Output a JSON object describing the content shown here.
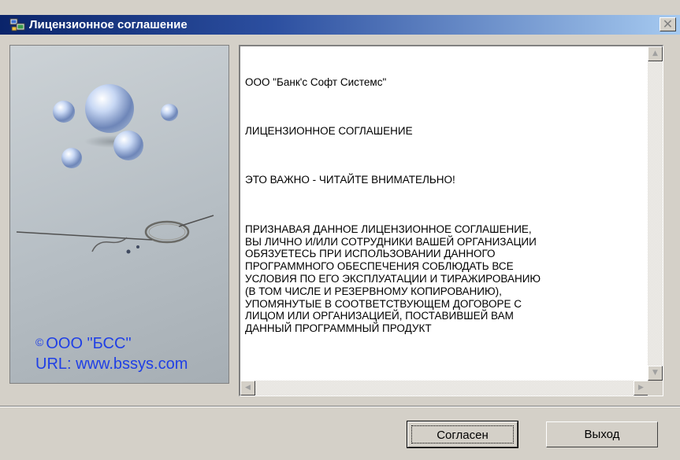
{
  "window": {
    "title": "Лицензионное соглашение",
    "close_symbol": "✕"
  },
  "image_panel": {
    "copyright_symbol": "©",
    "copyright_text": "ООО \"БСС\"",
    "url_text": "URL: www.bssys.com"
  },
  "license": {
    "paragraphs": [
      "ООО \"Банк'с Софт Системс\"",
      "ЛИЦЕНЗИОННОЕ СОГЛАШЕНИЕ",
      "ЭТО ВАЖНО - ЧИТАЙТЕ ВНИМАТЕЛЬНО!",
      "ПРИЗНАВАЯ ДАННОЕ ЛИЦЕНЗИОННОЕ СОГЛАШЕНИЕ,\nВЫ ЛИЧНО И/ИЛИ СОТРУДНИКИ ВАШЕЙ ОРГАНИЗАЦИИ\nОБЯЗУЕТЕСЬ ПРИ ИСПОЛЬЗОВАНИИ ДАННОГО\nПРОГРАММНОГО ОБЕСПЕЧЕНИЯ СОБЛЮДАТЬ ВСЕ\nУСЛОВИЯ ПО ЕГО ЭКСПЛУАТАЦИИ И ТИРАЖИРОВАНИЮ\n(В ТОМ ЧИСЛЕ И РЕЗЕРВНОМУ КОПИРОВАНИЮ),\nУПОМЯНУТЫЕ В СООТВЕТСТВУЮЩЕМ ДОГОВОРЕ С\nЛИЦОМ ИЛИ ОРГАНИЗАЦИЕЙ, ПОСТАВИВШЕЙ ВАМ\nДАННЫЙ ПРОГРАММНЫЙ ПРОДУКТ"
    ]
  },
  "scrollbar": {
    "up_arrow": "▲",
    "down_arrow": "▼",
    "left_arrow": "◀",
    "right_arrow": "▶"
  },
  "buttons": {
    "agree_label": "Согласен",
    "exit_label": "Выход"
  },
  "icons": {
    "title_icon": "app-computers-icon",
    "close_icon": "close-icon"
  },
  "colors": {
    "title_bar_start": "#0a246a",
    "title_bar_end": "#a6caf0",
    "dialog_face": "#d4d0c8",
    "link_blue": "#1f3fe6"
  }
}
